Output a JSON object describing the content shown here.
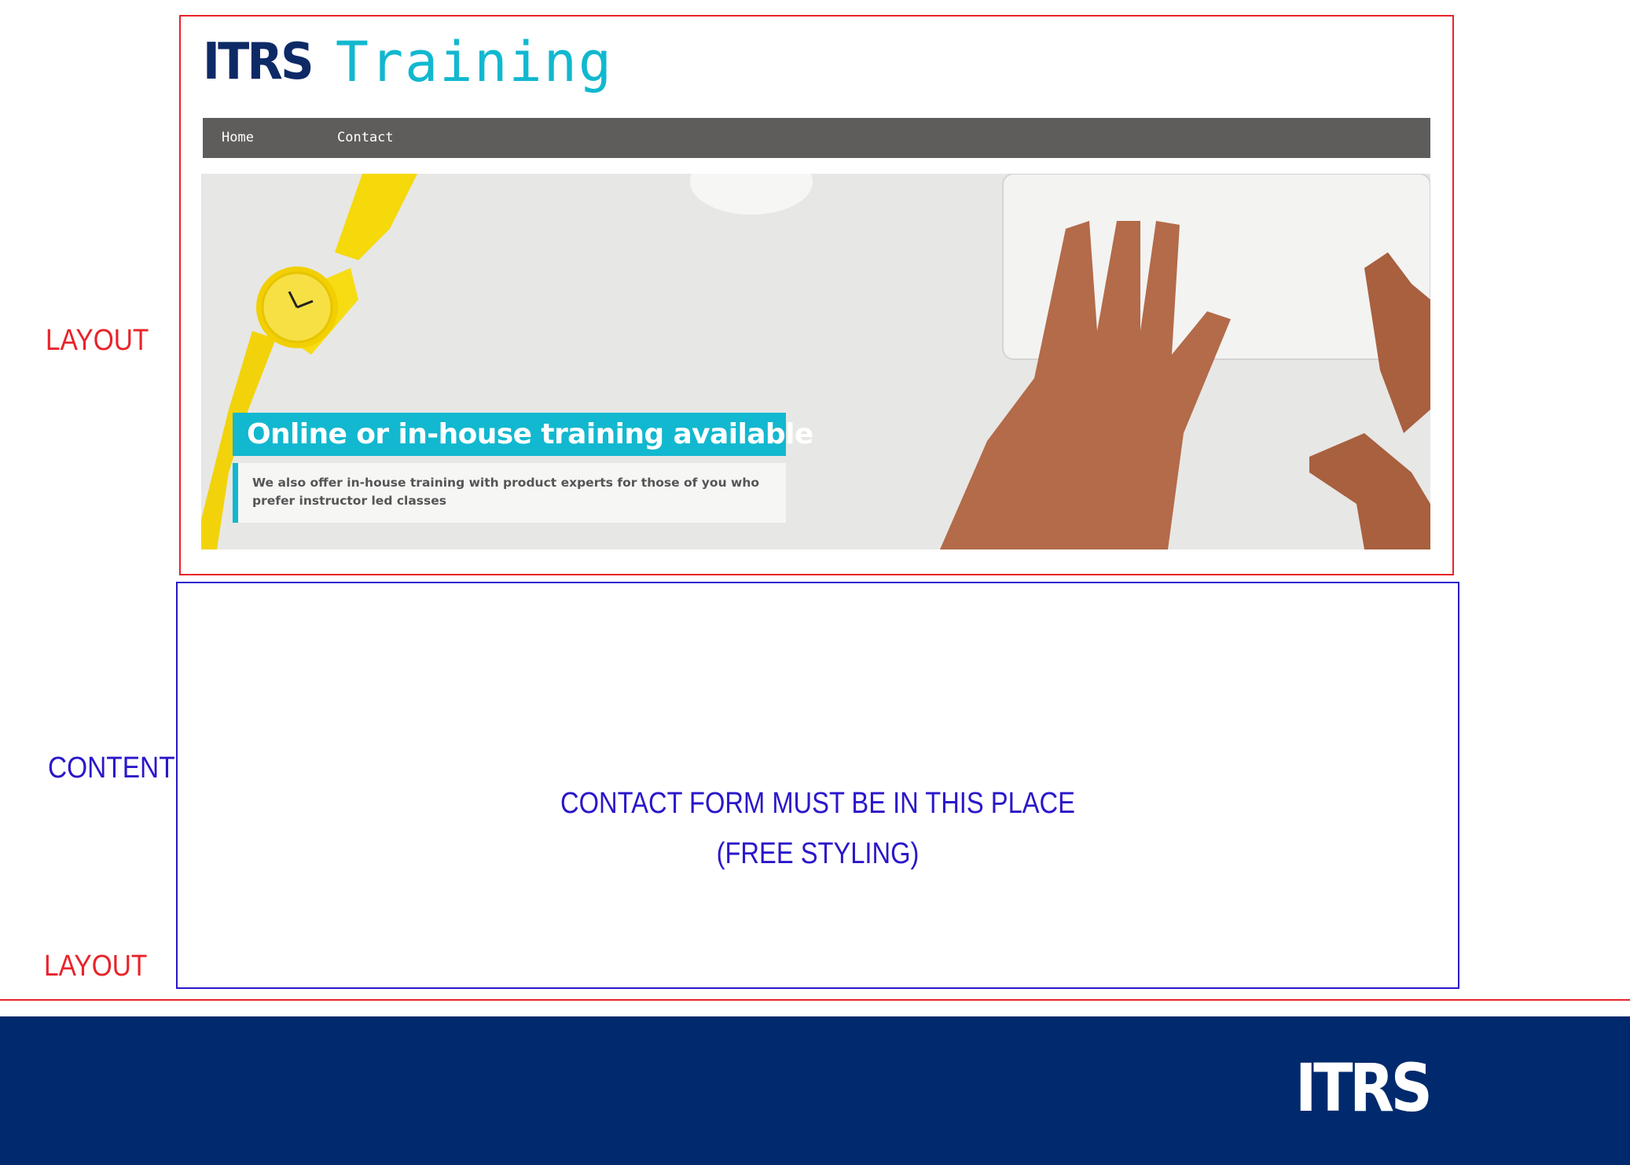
{
  "annotations": {
    "layout_top": "LAYOUT",
    "content": "CONTENT",
    "layout_bottom": "LAYOUT",
    "content_placeholder_line1": "CONTACT FORM MUST BE IN THIS PLACE",
    "content_placeholder_line2": "(FREE STYLING)"
  },
  "header": {
    "brand": "ITRS",
    "brand_word": "Training"
  },
  "nav": {
    "items": [
      {
        "label": "Home"
      },
      {
        "label": "Contact"
      }
    ]
  },
  "hero": {
    "title": "Online or in-house training available",
    "description": "We also offer in-house training with product experts for those of you who prefer instructor led classes"
  },
  "footer": {
    "brand": "ITRS"
  },
  "colors": {
    "annotation_red": "#e8232a",
    "annotation_blue": "#2a17c9",
    "brand_navy": "#0e2a66",
    "accent_cyan": "#12b8cf",
    "nav_gray": "#5e5d5c",
    "footer_navy": "#002a6d"
  }
}
